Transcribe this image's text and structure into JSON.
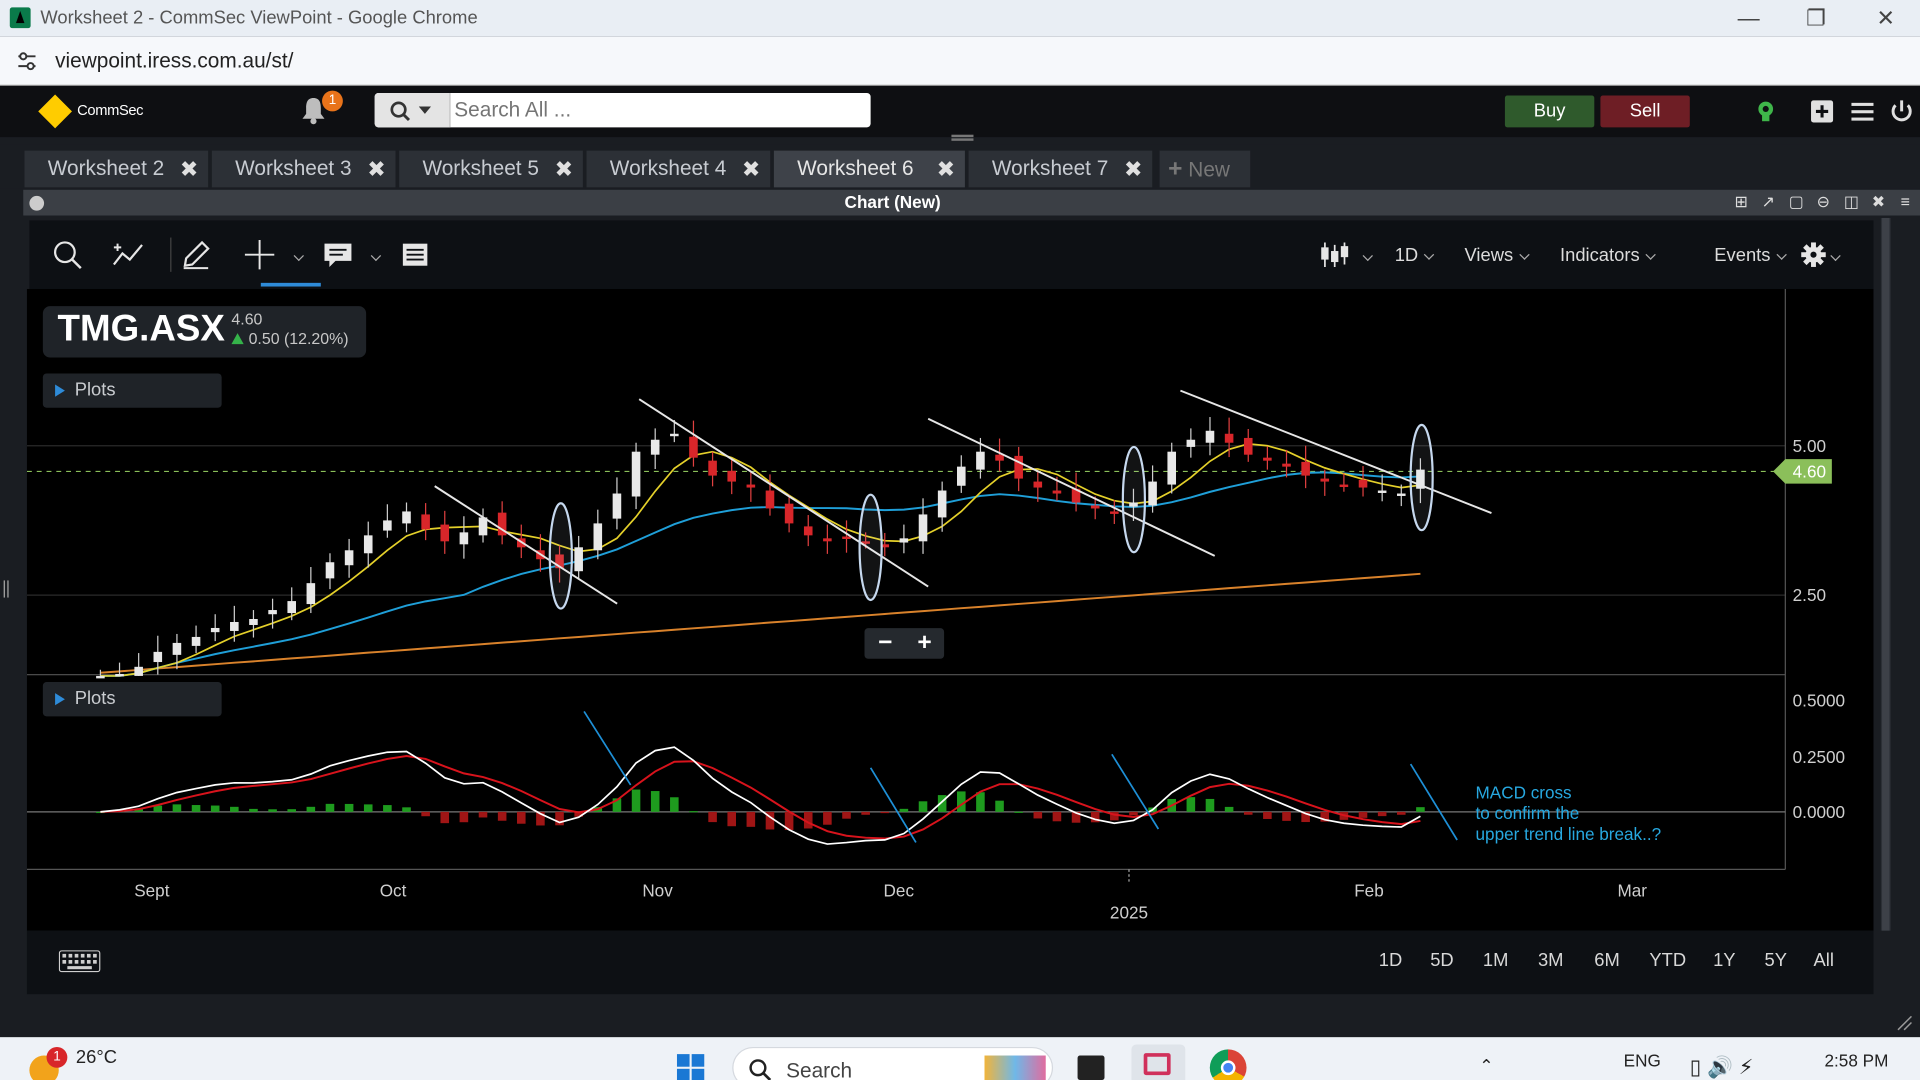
{
  "window": {
    "title": "Worksheet 2 - CommSec ViewPoint - Google Chrome",
    "url": "viewpoint.iress.com.au/st/"
  },
  "header": {
    "brand": "CommSec",
    "notifications": "1",
    "search_placeholder": "Search All ...",
    "buy_label": "Buy",
    "sell_label": "Sell",
    "icons": [
      "bell-icon",
      "search-icon",
      "lightbulb-icon",
      "plus-icon",
      "menu-icon",
      "power-icon"
    ]
  },
  "tabs": [
    {
      "label": "Worksheet 2",
      "active": false
    },
    {
      "label": "Worksheet 3",
      "active": false
    },
    {
      "label": "Worksheet 5",
      "active": false
    },
    {
      "label": "Worksheet 4",
      "active": false
    },
    {
      "label": "Worksheet 6",
      "active": true
    },
    {
      "label": "Worksheet 7",
      "active": false
    }
  ],
  "new_tab_label": "New",
  "panel": {
    "title": "Chart (New)"
  },
  "toolbar": {
    "interval": "1D",
    "views": "Views",
    "indicators": "Indicators",
    "events": "Events"
  },
  "symbol": {
    "code": "TMG.ASX",
    "price": "4.60",
    "change": "0.50 (12.20%)"
  },
  "plots_label": "Plots",
  "chart_data": [
    {
      "type": "candlestick",
      "title": "TMG.ASX",
      "y_ticks": [
        "5.00",
        "2.50"
      ],
      "last_price_label": "4.60",
      "series": [
        {
          "name": "",
          "color": "#e4d02a"
        },
        {
          "name": "",
          "color": "#1f9fd8"
        },
        {
          "name": "",
          "color": "#d9822b"
        }
      ],
      "close": [
        1.1,
        1.18,
        1.3,
        1.55,
        1.7,
        1.8,
        1.95,
        2.05,
        2.1,
        2.25,
        2.4,
        2.7,
        3.05,
        3.25,
        3.5,
        3.75,
        3.9,
        3.6,
        3.4,
        3.55,
        3.8,
        3.5,
        3.3,
        3.1,
        2.95,
        3.3,
        3.7,
        4.2,
        4.9,
        5.1,
        5.2,
        4.8,
        4.5,
        4.4,
        4.3,
        3.95,
        3.7,
        3.5,
        3.4,
        3.45,
        3.4,
        3.3,
        3.45,
        3.85,
        4.25,
        4.65,
        4.9,
        4.75,
        4.45,
        4.3,
        4.2,
        4.05,
        3.95,
        3.9,
        4.05,
        4.4,
        4.9,
        5.1,
        5.25,
        5.05,
        4.85,
        4.75,
        4.65,
        4.5,
        4.4,
        4.35,
        4.3,
        4.25,
        4.2,
        4.6
      ],
      "annotations": [
        "downtrend-lines",
        "breakout-ellipses"
      ]
    },
    {
      "type": "line",
      "y_ticks": [
        "0.5000",
        "0.2500",
        "0.0000"
      ],
      "series": [
        {
          "name": "",
          "color": "#ffffff"
        },
        {
          "name": "",
          "color": "#d8131c"
        }
      ],
      "annotation": "MACD cross\nto confirm the\nupper trend line break..?"
    }
  ],
  "x_axis": {
    "labels": [
      "Sept",
      "Oct",
      "Nov",
      "Dec",
      "Feb",
      "Mar"
    ],
    "year_label": "2025"
  },
  "ranges": [
    "1D",
    "5D",
    "1M",
    "3M",
    "6M",
    "YTD",
    "1Y",
    "5Y",
    "All"
  ],
  "taskbar": {
    "temp": "26°C",
    "weather_badge": "1",
    "search": "Search",
    "lang": "ENG",
    "time": "2:58 PM"
  }
}
